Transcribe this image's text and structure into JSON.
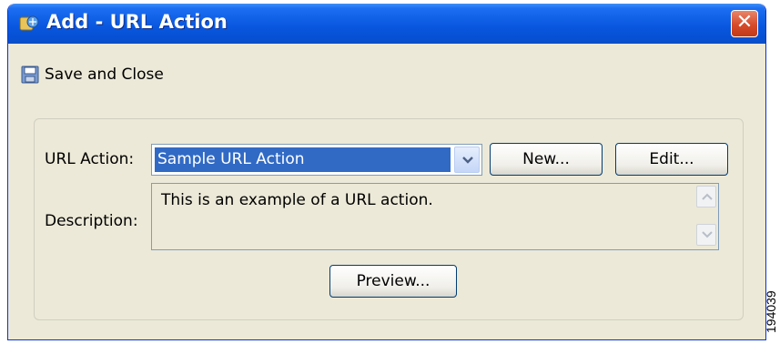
{
  "window": {
    "title": "Add - URL Action",
    "title_icon": "url-action-icon",
    "close_icon": "close-icon",
    "colors": {
      "titlebar": "#0a58e0",
      "background": "#ece9d8",
      "close": "#d64b2a",
      "selection": "#316ac5"
    }
  },
  "toolbar": {
    "save_label": "Save and Close",
    "save_icon": "save-icon"
  },
  "form": {
    "url_action_label": "URL Action:",
    "url_action_value": "Sample URL Action",
    "new_label": "New...",
    "edit_label": "Edit...",
    "description_label": "Description:",
    "description_value": "This is an example of a URL action.",
    "preview_label": "Preview..."
  },
  "figure_id": "194039"
}
